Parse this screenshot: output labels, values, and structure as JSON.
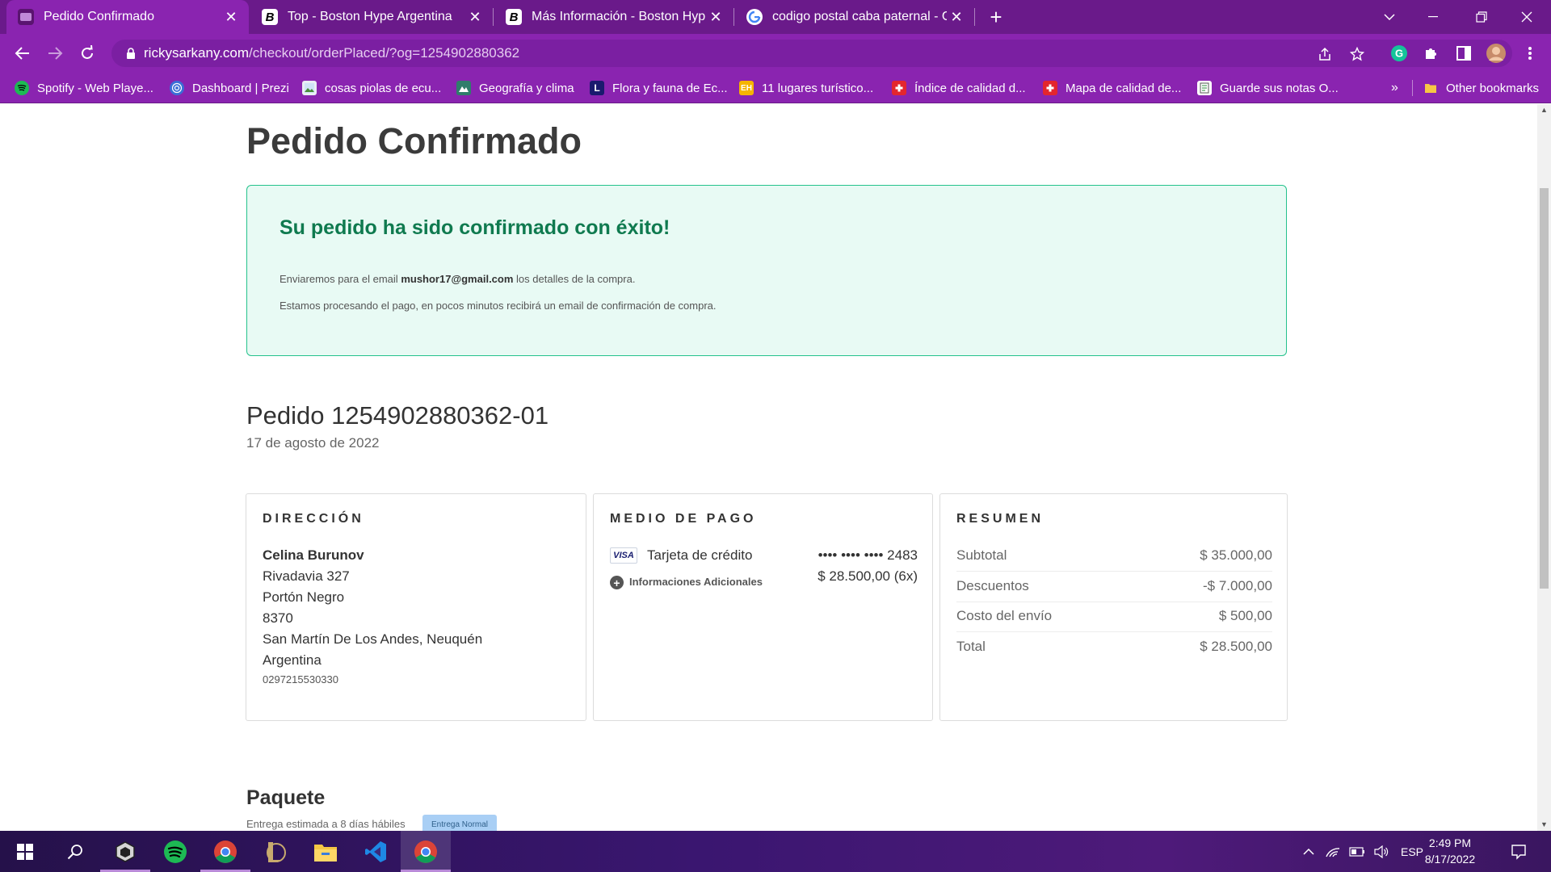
{
  "browser": {
    "tabs": [
      {
        "title": "Pedido Confirmado",
        "favicon": "purple-page-icon",
        "active": true
      },
      {
        "title": "Top - Boston Hype Argentina",
        "favicon": "boston-hype-b-icon",
        "active": false
      },
      {
        "title": "Más Información - Boston Hype A",
        "favicon": "boston-hype-b-icon",
        "active": false
      },
      {
        "title": "codigo postal caba paternal - Go",
        "favicon": "google-g-icon",
        "active": false
      }
    ],
    "new_tab_symbol": "+",
    "address": {
      "host": "rickysarkany.com",
      "path": "/checkout/orderPlaced/?og=1254902880362"
    },
    "bookmarks": [
      {
        "label": "Spotify - Web Playe...",
        "icon": "spotify-icon"
      },
      {
        "label": "Dashboard | Prezi",
        "icon": "prezi-icon"
      },
      {
        "label": "cosas piolas de ecu...",
        "icon": "image-icon"
      },
      {
        "label": "Geografía y clima",
        "icon": "landscape-icon"
      },
      {
        "label": "Flora y fauna de Ec...",
        "icon": "letter-l-icon"
      },
      {
        "label": "11 lugares turístico...",
        "icon": "eh-icon"
      },
      {
        "label": "Índice de calidad d...",
        "icon": "swiss-cross-icon"
      },
      {
        "label": "Mapa de calidad de...",
        "icon": "swiss-cross-icon"
      },
      {
        "label": "Guarde sus notas O...",
        "icon": "notes-icon"
      }
    ],
    "bookmarks_overflow": "»",
    "other_bookmarks": "Other bookmarks"
  },
  "page": {
    "title": "Pedido Confirmado",
    "success": {
      "title": "Su pedido ha sido confirmado con éxito!",
      "email_prefix": "Enviaremos para el email",
      "email": "mushor17@gmail.com",
      "email_suffix": "los detalles de la compra.",
      "processing": "Estamos procesando el pago, en pocos minutos recibirá un email de confirmación de compra."
    },
    "order": {
      "heading": "Pedido 1254902880362-01",
      "date": "17 de agosto de 2022"
    },
    "address": {
      "label": "DIRECCIÓN",
      "name": "Celina Burunov",
      "street": "Rivadavia 327",
      "complement": "Portón Negro",
      "zip": "8370",
      "city": "San Martín De Los Andes, Neuquén",
      "country": "Argentina",
      "phone": "0297215530330"
    },
    "payment": {
      "label": "MEDIO DE PAGO",
      "card_brand": "VISA",
      "type": "Tarjeta de crédito",
      "card_number": "•••• •••• •••• 2483",
      "more_info": "Informaciones Adicionales",
      "amount": "$ 28.500,00 (6x)"
    },
    "summary": {
      "label": "RESUMEN",
      "rows": [
        {
          "label": "Subtotal",
          "value": "$ 35.000,00"
        },
        {
          "label": "Descuentos",
          "value": "-$ 7.000,00"
        },
        {
          "label": "Costo del envío",
          "value": "$ 500,00"
        },
        {
          "label": "Total",
          "value": "$ 28.500,00"
        }
      ]
    },
    "package": {
      "title": "Paquete",
      "estimate": "Entrega estimada a 8 días hábiles",
      "badge": "Entrega Normal"
    }
  },
  "taskbar": {
    "language": "ESP",
    "time": "2:49 PM",
    "date": "8/17/2022"
  },
  "colors": {
    "browser_frame": "#6a1a8a",
    "toolbar": "#8a24b0",
    "success_bg": "#e8faf4",
    "success_border": "#25c28c",
    "success_text": "#0f7a4f"
  }
}
